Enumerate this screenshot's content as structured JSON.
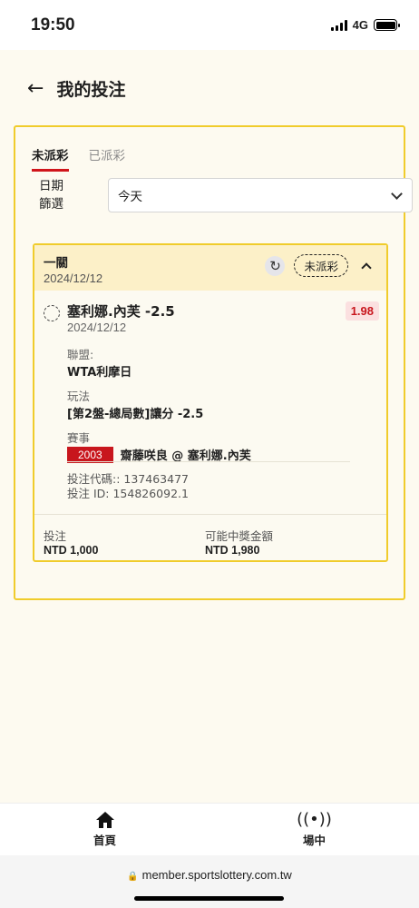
{
  "status_bar": {
    "time": "19:50",
    "network": "4G"
  },
  "header": {
    "back_icon": "←",
    "title": "我的投注"
  },
  "tabs": [
    {
      "label": "未派彩",
      "active": true
    },
    {
      "label": "已派彩",
      "active": false
    }
  ],
  "date_filter": {
    "label_line1": "日期",
    "label_line2": "篩選",
    "selected": "今天"
  },
  "bet": {
    "type": "一關",
    "date": "2024/12/12",
    "status": "未派彩",
    "selection": {
      "name": "塞利娜.內芙 -2.5",
      "date": "2024/12/12",
      "odds": "1.98"
    },
    "league_label": "聯盟:",
    "league_value": "WTA利摩日",
    "market_label": "玩法",
    "market_value": "[第2盤-總局數]讓分 -2.5",
    "event_label": "賽事",
    "event_code": "2003",
    "event_name": "齋藤咲良 @ 塞利娜.內芙",
    "bet_code_line": "投注代碼:: 137463477",
    "bet_id_line": "投注 ID: 154826092.1",
    "stake_label": "投注",
    "stake_value": "NTD 1,000",
    "payout_label": "可能中獎金額",
    "payout_value": "NTD 1,980"
  },
  "bottom_nav": [
    {
      "label": "首頁",
      "icon": "home-icon"
    },
    {
      "label": "場中",
      "icon": "live-broadcast-icon"
    }
  ],
  "browser": {
    "url": "member.sportslottery.com.tw"
  },
  "colors": {
    "accent": "#f0cc2c",
    "red": "#c8161d",
    "background": "#fdfaf0"
  }
}
